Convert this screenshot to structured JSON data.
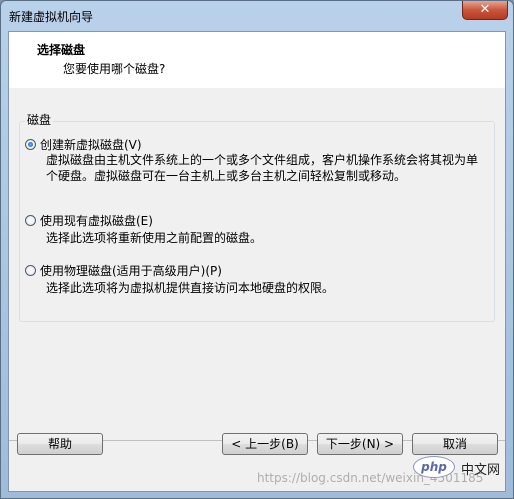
{
  "window": {
    "title": "新建虚拟机向导",
    "close_label": "✕"
  },
  "header": {
    "title": "选择磁盘",
    "subtitle": "您要使用哪个磁盘?"
  },
  "group": {
    "label": "磁盘"
  },
  "options": [
    {
      "label": "创建新虚拟磁盘(V)",
      "checked": true,
      "desc_line1": "虚拟磁盘由主机文件系统上的一个或多个文件组成，客户机操作系统会将其视为单",
      "desc_line2": "个硬盘。虚拟磁盘可在一台主机上或多台主机之间轻松复制或移动。"
    },
    {
      "label": "使用现有虚拟磁盘(E)",
      "checked": false,
      "desc_line1": "选择此选项将重新使用之前配置的磁盘。"
    },
    {
      "label": "使用物理磁盘(适用于高级用户)(P)",
      "checked": false,
      "desc_line1": "选择此选项将为虚拟机提供直接访问本地硬盘的权限。"
    }
  ],
  "buttons": {
    "help": "帮助",
    "back": "< 上一步(B)",
    "next": "下一步(N) >",
    "cancel": "取消"
  },
  "watermark": {
    "text": "https://blog.csdn.net/weixin_4501185",
    "logo": "php",
    "site": "中文网"
  }
}
